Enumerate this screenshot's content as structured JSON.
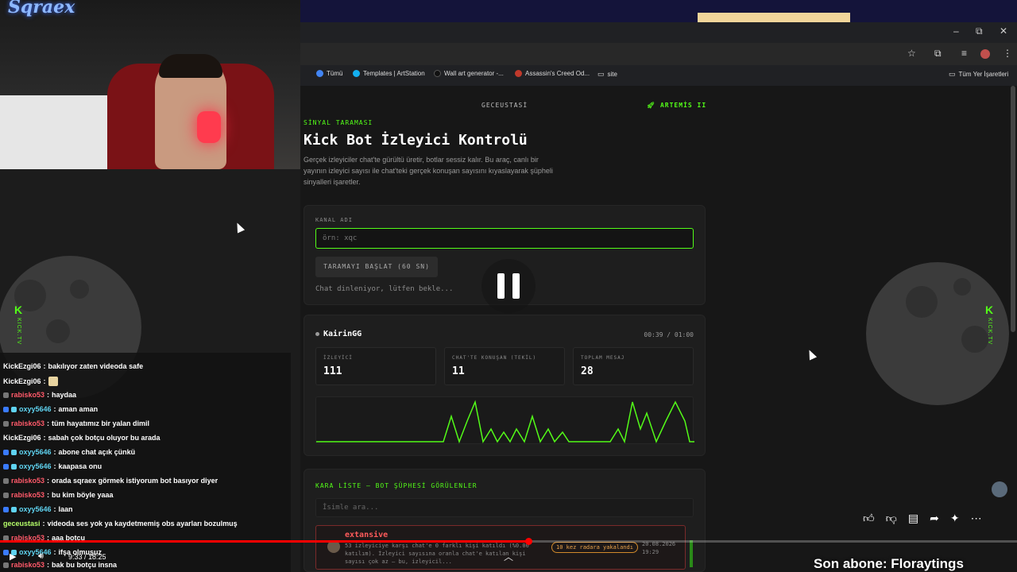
{
  "webcam": {
    "channel_logo": "Sqraex"
  },
  "browser": {
    "window_controls": {
      "minimize": "–",
      "restore": "⧉",
      "close": "✕"
    },
    "bookmarks": [
      {
        "label": "Tümü",
        "color": "#4285f4"
      },
      {
        "label": "Templates | ArtStation",
        "color": "#13aff0"
      },
      {
        "label": "Wall art generator -...",
        "color": "#111111"
      },
      {
        "label": "Assassin's Creed Od...",
        "color": "#c0392b"
      },
      {
        "label": "site",
        "color": "#cccccc"
      }
    ],
    "all_bookmarks": "Tüm Yer İşaretleri"
  },
  "page": {
    "brand": "GECEUSTASİ",
    "artemis": "ARTEMİS II",
    "eyebrow": "SİNYAL TARAMASI",
    "title": "Kick Bot İzleyici Kontrolü",
    "description": "Gerçek izleyiciler chat'te gürültü üretir, botlar sessiz kalır. Bu araç, canlı bir yayının izleyici sayısı ile chat'teki gerçek konuşan sayısını kıyaslayarak şüpheli sinyalleri işaretler.",
    "channel_label": "KANAL ADI",
    "channel_placeholder": "örn: xqc",
    "scan_button": "TARAMAYI BAŞLAT (60 SN)",
    "status": "Chat dinleniyor, lütfen bekle...",
    "live": {
      "channel": "KairinGG",
      "timer": "00:39 / 01:00",
      "stats": [
        {
          "label": "İZLEYİCİ",
          "value": "111"
        },
        {
          "label": "CHAT'TE KONUŞAN (TEKİL)",
          "value": "11"
        },
        {
          "label": "TOPLAM MESAJ",
          "value": "28"
        }
      ]
    },
    "blacklist": {
      "title": "KARA LİSTE — BOT ŞÜPHESİ GÖRÜLENLER",
      "search_placeholder": "İsimle ara...",
      "entry": {
        "name": "extansive",
        "text": "53 izleyiciye karşı chat'e 0 farklı kişi katıldı (%0.00 katılım). İzleyici sayısına oranla chat'e katılan kişi sayısı çok az — bu, izleyicil...",
        "badge": "10 kez radara yakalandı",
        "date": "20.08.2026",
        "time": "19:29"
      }
    }
  },
  "chat": [
    {
      "user": "KickEzgi06",
      "text": "bakılıyor zaten videoda safe",
      "color": "#ffffff"
    },
    {
      "user": "KickEzgi06",
      "text": "",
      "color": "#ffffff"
    },
    {
      "user": "rabisko53",
      "text": "haydaa",
      "color": "#ff5a6a"
    },
    {
      "user": "oxyy5646",
      "text": "aman aman",
      "color": "#5fd3f0"
    },
    {
      "user": "rabisko53",
      "text": "tüm hayatımız bir yalan dimil",
      "color": "#ff5a6a"
    },
    {
      "user": "KickEzgi06",
      "text": "sabah çok botçu oluyor bu arada",
      "color": "#ffffff"
    },
    {
      "user": "oxyy5646",
      "text": "abone chat açık çünkü",
      "color": "#5fd3f0"
    },
    {
      "user": "oxyy5646",
      "text": "kaapasa onu",
      "color": "#5fd3f0"
    },
    {
      "user": "rabisko53",
      "text": "orada sqraex görmek istiyorum bot basıyor diyer",
      "color": "#ff5a6a"
    },
    {
      "user": "rabisko53",
      "text": "bu kim böyle yaaa",
      "color": "#ff5a6a"
    },
    {
      "user": "oxyy5646",
      "text": "laan",
      "color": "#5fd3f0"
    },
    {
      "user": "geceustasi",
      "text": "videoda ses yok ya kaydetmemiş obs ayarları bozulmuş",
      "color": "#b6ff6a"
    },
    {
      "user": "rabisko53",
      "text": "aaa botçu",
      "color": "#ff5a6a"
    },
    {
      "user": "oxyy5646",
      "text": "ifşa olmuşuz",
      "color": "#5fd3f0"
    },
    {
      "user": "rabisko53",
      "text": "bak bu botçu insna",
      "color": "#ff5a6a"
    }
  ],
  "player": {
    "time": "9:33 / 18:25",
    "progress": 0.52
  },
  "subscriber_banner": "Son abone: Floraytings"
}
